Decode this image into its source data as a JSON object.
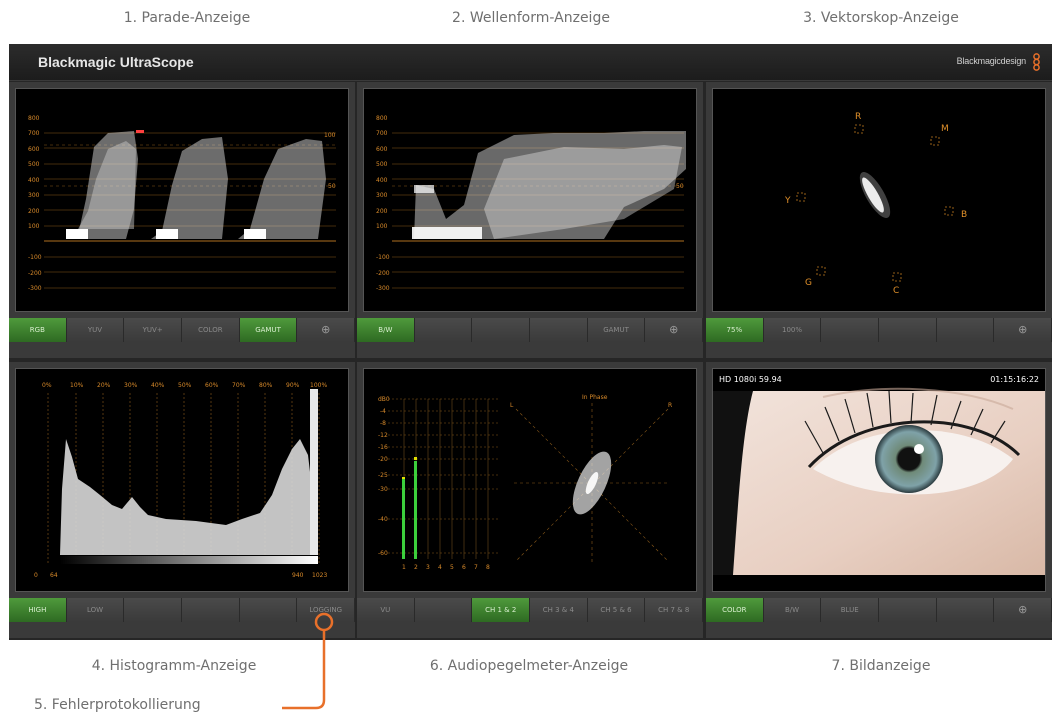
{
  "captions": {
    "parade": "1. Parade-Anzeige",
    "waveform": "2. Wellenform-Anzeige",
    "vectorscope": "3. Vektorskop-Anzeige",
    "histogram": "4. Histogramm-Anzeige",
    "error_logging": "5. Fehlerprotokollierung",
    "audio": "6. Audiopegelmeter-Anzeige",
    "picture": "7. Bildanzeige"
  },
  "app": {
    "title": "Blackmagic UltraScope",
    "brand": "Blackmagicdesign"
  },
  "colors": {
    "accent_orange": "#e8702a",
    "active_green": "#3f8a2f",
    "trace_orange": "#d88a2a"
  },
  "parade": {
    "y_ticks": [
      "800",
      "700",
      "600",
      "500",
      "400",
      "300",
      "200",
      "100",
      "-100",
      "-200",
      "-300"
    ],
    "markers": [
      "100",
      "50"
    ],
    "buttons": [
      {
        "label": "RGB",
        "active": true
      },
      {
        "label": "YUV",
        "active": false
      },
      {
        "label": "YUV+",
        "active": false
      },
      {
        "label": "COLOR",
        "active": false
      },
      {
        "label": "GAMUT",
        "active": true
      }
    ],
    "zoom_icon": "zoom-in-icon"
  },
  "waveform": {
    "y_ticks": [
      "800",
      "700",
      "600",
      "500",
      "400",
      "300",
      "200",
      "100",
      "-100",
      "-200",
      "-300"
    ],
    "marker": "50",
    "buttons": [
      {
        "label": "B/W",
        "active": true
      },
      {
        "label": "GAMUT",
        "active": false
      }
    ],
    "zoom_icon": "zoom-in-icon"
  },
  "vectorscope": {
    "targets": [
      "R",
      "M",
      "Y",
      "B",
      "G",
      "C"
    ],
    "buttons": [
      {
        "label": "75%",
        "active": true
      },
      {
        "label": "100%",
        "active": false
      }
    ],
    "zoom_icon": "zoom-in-icon"
  },
  "histogram": {
    "x_ticks": [
      "0%",
      "10%",
      "20%",
      "30%",
      "40%",
      "50%",
      "60%",
      "70%",
      "80%",
      "90%",
      "100%"
    ],
    "bottom_left": [
      "0",
      "64"
    ],
    "bottom_right": [
      "940",
      "1023"
    ],
    "buttons": [
      {
        "label": "HIGH",
        "active": true
      },
      {
        "label": "LOW",
        "active": false
      },
      {
        "label": "LOGGING",
        "active": false
      }
    ]
  },
  "audio": {
    "db_ticks": [
      "dB0",
      "-4",
      "-8",
      "-12",
      "-16",
      "-20",
      "-25",
      "-30",
      "-40",
      "-60"
    ],
    "channels": [
      "1",
      "2",
      "3",
      "4",
      "5",
      "6",
      "7",
      "8"
    ],
    "levels_db": [
      -25,
      -16,
      null,
      null,
      null,
      null,
      null,
      null
    ],
    "phase_label": "In Phase",
    "corner_left": "L",
    "corner_right": "R",
    "buttons": [
      {
        "label": "VU",
        "active": false
      },
      {
        "label": "CH 1 & 2",
        "active": true
      },
      {
        "label": "CH 3 & 4",
        "active": false
      },
      {
        "label": "CH 5 & 6",
        "active": false
      },
      {
        "label": "CH 7 & 8",
        "active": false
      }
    ]
  },
  "picture": {
    "format": "HD 1080i 59.94",
    "timecode": "01:15:16:22",
    "buttons": [
      {
        "label": "COLOR",
        "active": true
      },
      {
        "label": "B/W",
        "active": false
      },
      {
        "label": "BLUE",
        "active": false
      }
    ],
    "zoom_icon": "zoom-in-icon"
  }
}
